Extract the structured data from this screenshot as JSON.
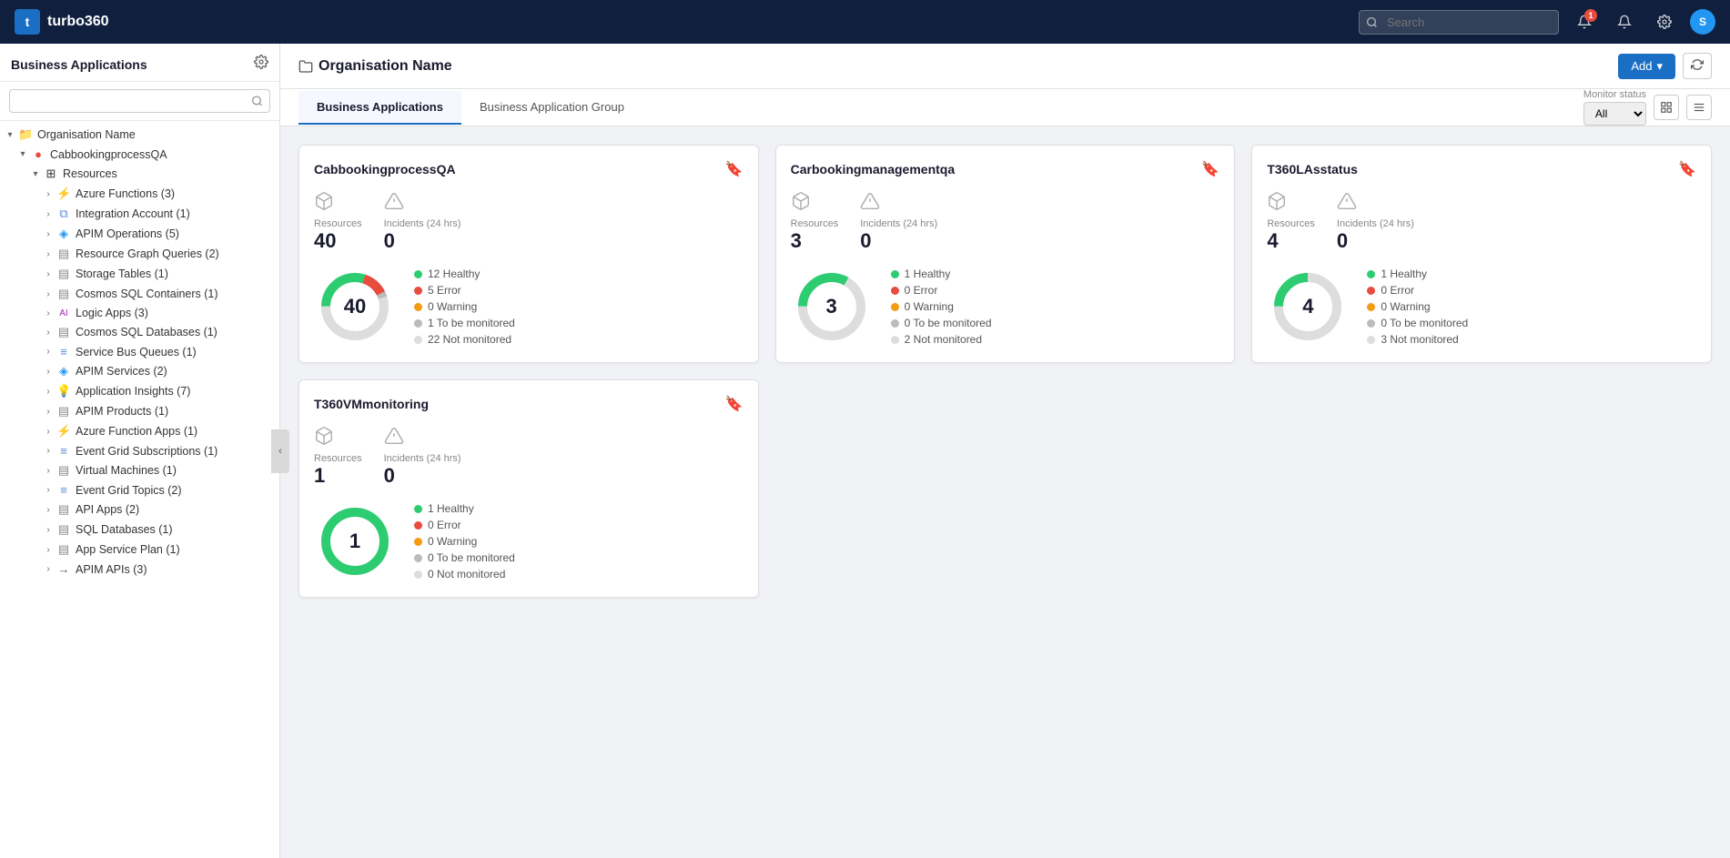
{
  "app": {
    "name": "turbo360",
    "logo_letter": "t"
  },
  "topnav": {
    "search_placeholder": "Search",
    "notification_count": "1",
    "avatar_letter": "S",
    "add_label": "Add",
    "add_chevron": "▾"
  },
  "sidebar": {
    "title": "Business Applications",
    "search_placeholder": "",
    "org_name": "Organisation Name",
    "app_name": "CabbookingprocessQA",
    "resources_label": "Resources",
    "tree_items": [
      {
        "level": 3,
        "label": "Azure Functions (3)",
        "icon": "⚡"
      },
      {
        "level": 3,
        "label": "Integration Account (1)",
        "icon": "⧉"
      },
      {
        "level": 3,
        "label": "APIM Operations (5)",
        "icon": "🔷"
      },
      {
        "level": 3,
        "label": "Resource Graph Queries (2)",
        "icon": "⬛"
      },
      {
        "level": 3,
        "label": "Storage Tables (1)",
        "icon": "⬛"
      },
      {
        "level": 3,
        "label": "Cosmos SQL Containers (1)",
        "icon": "⬛"
      },
      {
        "level": 3,
        "label": "Logic Apps (3)",
        "icon": "AI"
      },
      {
        "level": 3,
        "label": "Cosmos SQL Databases (1)",
        "icon": "⬛"
      },
      {
        "level": 3,
        "label": "Service Bus Queues (1)",
        "icon": "≡"
      },
      {
        "level": 3,
        "label": "APIM Services (2)",
        "icon": "🔷"
      },
      {
        "level": 3,
        "label": "Application Insights (7)",
        "icon": "💡"
      },
      {
        "level": 3,
        "label": "APIM Products (1)",
        "icon": "⬛"
      },
      {
        "level": 3,
        "label": "Azure Function Apps (1)",
        "icon": "⚡"
      },
      {
        "level": 3,
        "label": "Event Grid Subscriptions (1)",
        "icon": "≡"
      },
      {
        "level": 3,
        "label": "Virtual Machines (1)",
        "icon": "⬛"
      },
      {
        "level": 3,
        "label": "Event Grid Topics (2)",
        "icon": "≡"
      },
      {
        "level": 3,
        "label": "API Apps (2)",
        "icon": "⬛"
      },
      {
        "level": 3,
        "label": "SQL Databases (1)",
        "icon": "⬛"
      },
      {
        "level": 3,
        "label": "App Service Plan (1)",
        "icon": "⬛"
      },
      {
        "level": 3,
        "label": "APIM APIs (3)",
        "icon": "→"
      }
    ]
  },
  "main": {
    "org_name": "Organisation Name",
    "tabs": [
      {
        "label": "Business Applications",
        "active": true
      },
      {
        "label": "Business Application Group",
        "active": false
      }
    ],
    "filter": {
      "label": "Monitor status",
      "options": [
        "All"
      ],
      "selected": "All"
    }
  },
  "cards": [
    {
      "id": "card1",
      "title": "CabbookingprocessQA",
      "resources_label": "Resources",
      "resources_count": "40",
      "incidents_label": "Incidents (24 hrs)",
      "incidents_count": "0",
      "donut_total": 40,
      "donut_segments": [
        {
          "value": 12,
          "color": "#2ecc71",
          "label": "12 Healthy"
        },
        {
          "value": 5,
          "color": "#e74c3c",
          "label": "5 Error"
        },
        {
          "value": 0,
          "color": "#f39c12",
          "label": "0 Warning"
        },
        {
          "value": 1,
          "color": "#bbb",
          "label": "1 To be monitored"
        },
        {
          "value": 22,
          "color": "#ddd",
          "label": "22 Not monitored"
        }
      ]
    },
    {
      "id": "card2",
      "title": "Carbookingmanagementqa",
      "resources_label": "Resources",
      "resources_count": "3",
      "incidents_label": "Incidents (24 hrs)",
      "incidents_count": "0",
      "donut_total": 3,
      "donut_segments": [
        {
          "value": 1,
          "color": "#2ecc71",
          "label": "1 Healthy"
        },
        {
          "value": 0,
          "color": "#e74c3c",
          "label": "0 Error"
        },
        {
          "value": 0,
          "color": "#f39c12",
          "label": "0 Warning"
        },
        {
          "value": 0,
          "color": "#bbb",
          "label": "0 To be monitored"
        },
        {
          "value": 2,
          "color": "#ddd",
          "label": "2 Not monitored"
        }
      ]
    },
    {
      "id": "card3",
      "title": "T360LAsstatus",
      "resources_label": "Resources",
      "resources_count": "4",
      "incidents_label": "Incidents (24 hrs)",
      "incidents_count": "0",
      "donut_total": 4,
      "donut_segments": [
        {
          "value": 1,
          "color": "#2ecc71",
          "label": "1 Healthy"
        },
        {
          "value": 0,
          "color": "#e74c3c",
          "label": "0 Error"
        },
        {
          "value": 0,
          "color": "#f39c12",
          "label": "0 Warning"
        },
        {
          "value": 0,
          "color": "#bbb",
          "label": "0 To be monitored"
        },
        {
          "value": 3,
          "color": "#ddd",
          "label": "3 Not monitored"
        }
      ]
    },
    {
      "id": "card4",
      "title": "T360VMmonitoring",
      "resources_label": "Resources",
      "resources_count": "1",
      "incidents_label": "Incidents (24 hrs)",
      "incidents_count": "0",
      "donut_total": 1,
      "donut_segments": [
        {
          "value": 1,
          "color": "#2ecc71",
          "label": "1 Healthy"
        },
        {
          "value": 0,
          "color": "#e74c3c",
          "label": "0 Error"
        },
        {
          "value": 0,
          "color": "#f39c12",
          "label": "0 Warning"
        },
        {
          "value": 0,
          "color": "#bbb",
          "label": "0 To be monitored"
        },
        {
          "value": 0,
          "color": "#ddd",
          "label": "0 Not monitored"
        }
      ]
    }
  ]
}
